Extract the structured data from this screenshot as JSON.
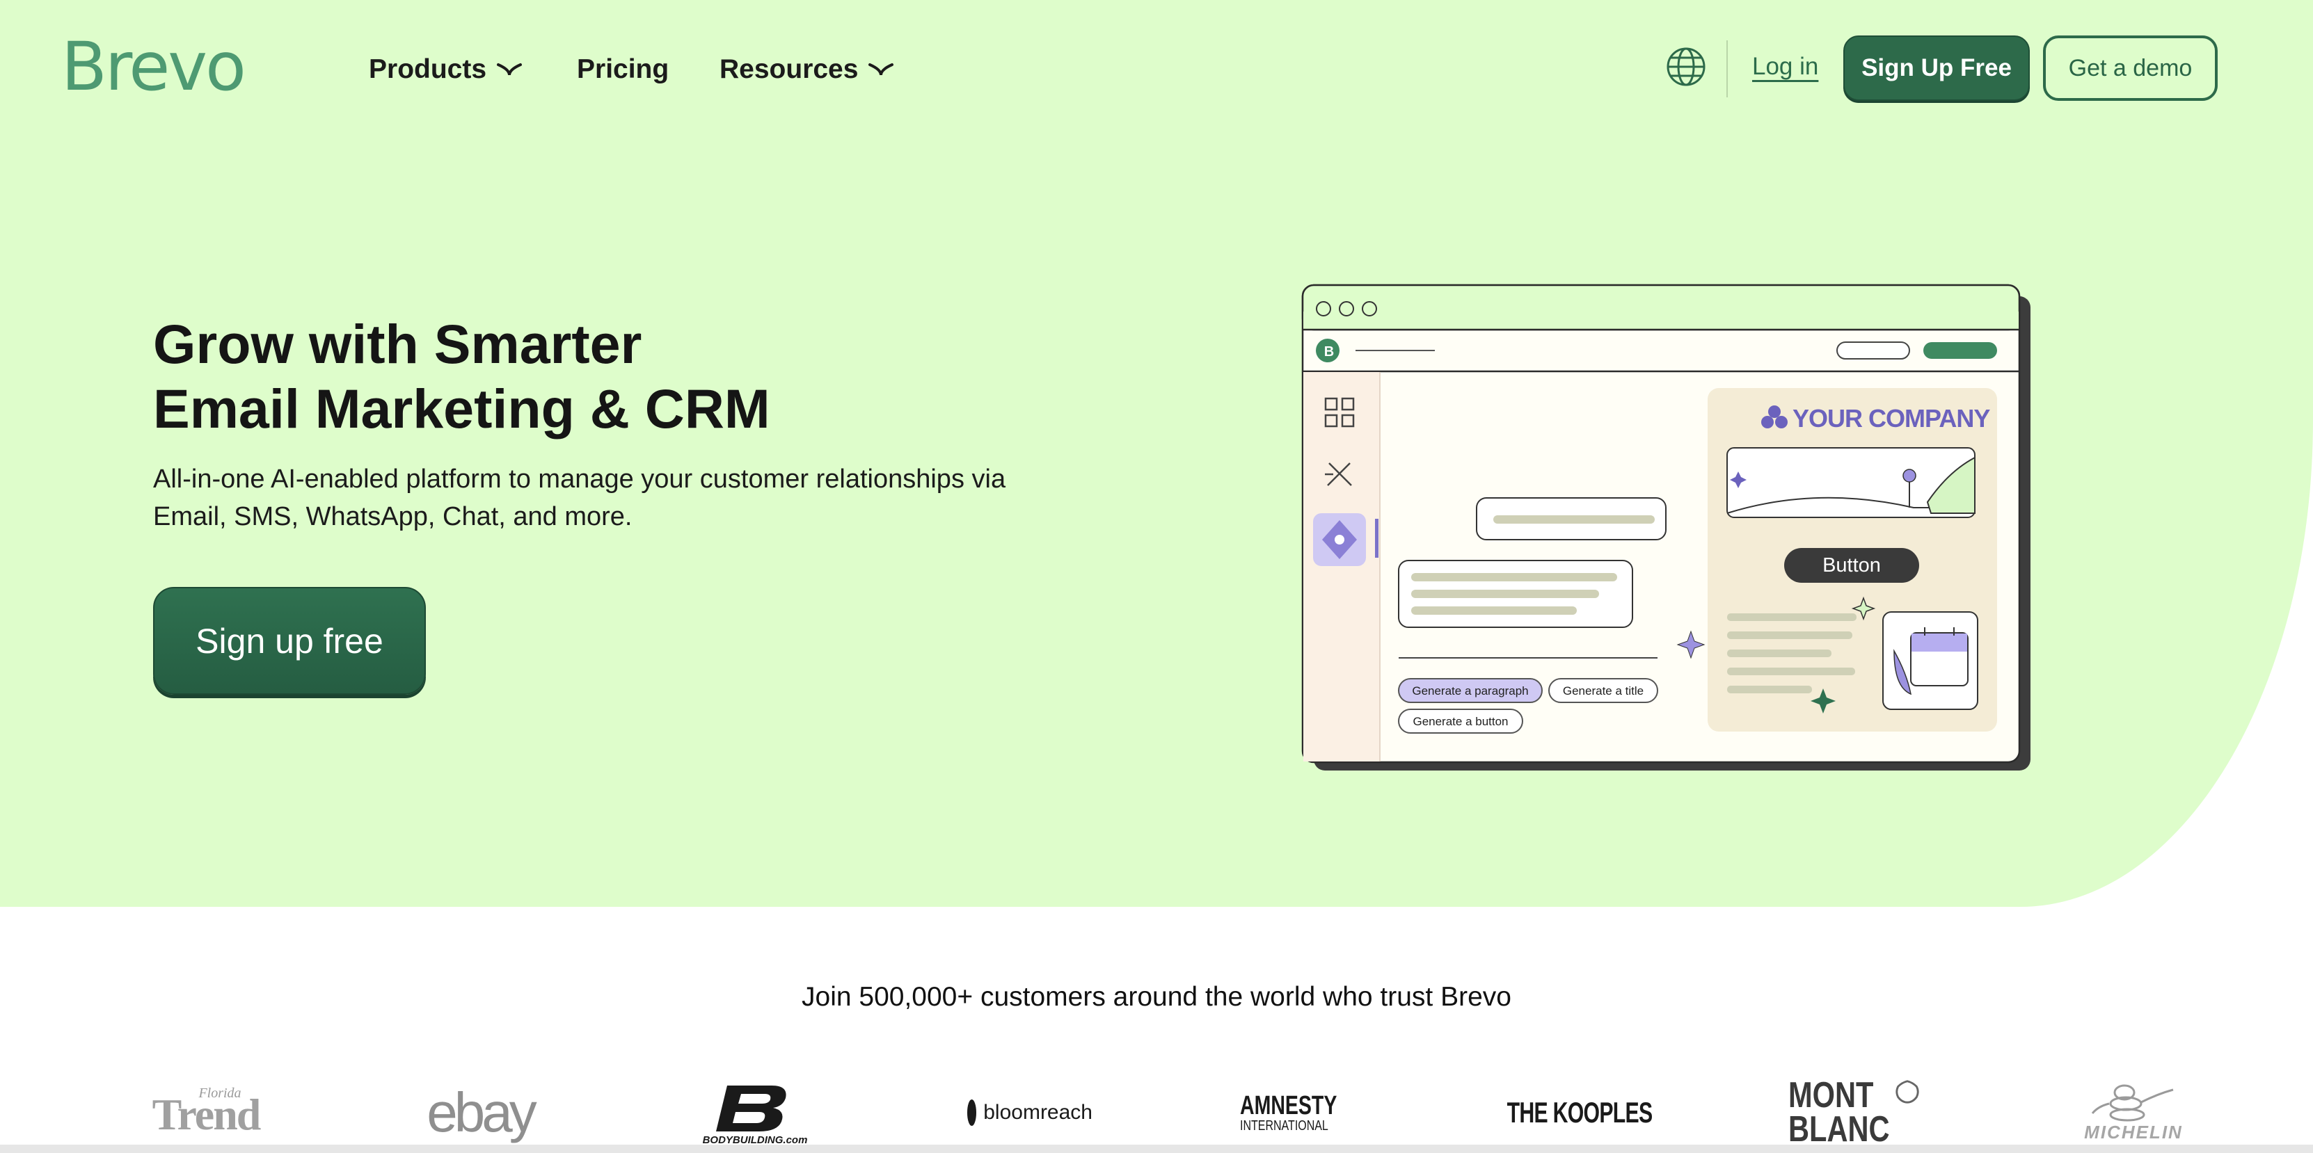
{
  "header": {
    "logo_text": "Brevo",
    "nav": [
      {
        "label": "Products",
        "has_dropdown": true
      },
      {
        "label": "Pricing",
        "has_dropdown": false
      },
      {
        "label": "Resources",
        "has_dropdown": true
      }
    ],
    "globe_icon": "globe-icon",
    "login_label": "Log in",
    "signup_label": "Sign Up Free",
    "demo_label": "Get a demo"
  },
  "hero": {
    "title_line1": "Grow with Smarter",
    "title_line2": "Email Marketing & CRM",
    "subtitle_line1": "All-in-one AI-enabled platform to manage your customer relationships via",
    "subtitle_line2": "Email, SMS, WhatsApp, Chat, and more.",
    "cta_label": "Sign up free"
  },
  "illustration": {
    "company_text": "YOUR COMPANY",
    "button_text": "Button",
    "chips": [
      "Generate a paragraph",
      "Generate a title",
      "Generate a button"
    ],
    "avatar_letter": "B"
  },
  "trust": {
    "heading": "Join 500,000+ customers around the world who trust Brevo",
    "logos": [
      {
        "name": "florida-trend-logo",
        "text_small": "Florida",
        "text": "Trend"
      },
      {
        "name": "ebay-logo",
        "text": "ebay"
      },
      {
        "name": "bodybuilding-logo",
        "text": "BODYBUILDING.com"
      },
      {
        "name": "bloomreach-logo",
        "text": "bloomreach"
      },
      {
        "name": "amnesty-logo",
        "text": "AMNESTY",
        "text2": "INTERNATIONAL"
      },
      {
        "name": "kooples-logo",
        "text": "THE KOOPLES"
      },
      {
        "name": "montblanc-logo",
        "text": "MONT",
        "text2": "BLANC"
      },
      {
        "name": "michelin-logo",
        "text": "MICHELIN"
      }
    ]
  },
  "colors": {
    "hero_bg": "#defdcb",
    "brand_green": "#2d6a4a",
    "logo_green": "#4e9a72",
    "accent_purple": "#7b72c9"
  }
}
